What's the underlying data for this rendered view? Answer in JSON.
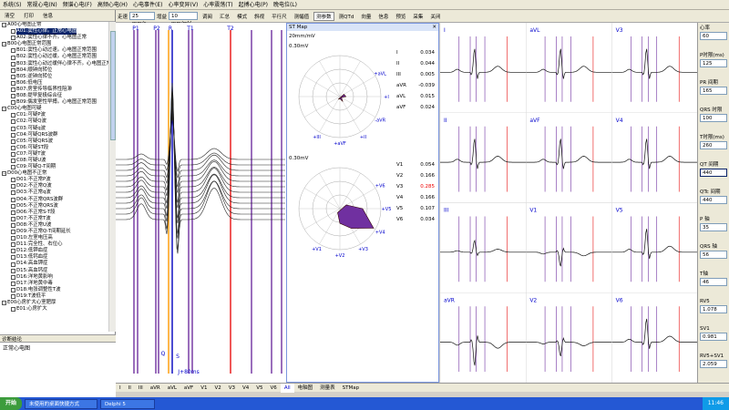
{
  "menu": [
    "系统(S)",
    "常规心电(N)",
    "频谱心电(F)",
    "高频心电(H)",
    "心电事件(E)",
    "心率变异(V)",
    "心率震荡(T)",
    "起搏心电(P)",
    "晚电位(L)"
  ],
  "toolbar": {
    "speed_label": "走速",
    "speed_value": "25 mm/s",
    "gain_label": "增益",
    "gain_value": "10 mm/mV",
    "buttons": [
      "调阅",
      "汇总",
      "模式",
      "斜视",
      "平行尺",
      "测幅值",
      "测参数",
      "测QTd",
      "向量",
      "信息",
      "预览",
      "采集",
      "关闭"
    ]
  },
  "left_header": {
    "clear": "清空",
    "print": "打印",
    "info": "信息"
  },
  "tree": [
    {
      "t": "A00心电图正常",
      "lvl": 0,
      "exp": true
    },
    {
      "t": "A01:窦性心律。正常心电图",
      "lvl": 1
    },
    {
      "t": "A02:窦性心律不齐。心电图正常",
      "lvl": 1
    },
    {
      "t": "B00心电图正常范围",
      "lvl": 0,
      "exp": true
    },
    {
      "t": "B01:窦性心动过速。心电图正常范围",
      "lvl": 1
    },
    {
      "t": "B02:窦性心动过缓。心电图正常范围",
      "lvl": 1
    },
    {
      "t": "B03:窦性心动过缓伴心律不齐。心电图正常范围",
      "lvl": 1
    },
    {
      "t": "B04:顺钟向转位",
      "lvl": 1
    },
    {
      "t": "B05:逆钟向转位",
      "lvl": 1
    },
    {
      "t": "B06:低电压",
      "lvl": 1
    },
    {
      "t": "B07:房室传导临界性阻滞",
      "lvl": 1
    },
    {
      "t": "B08:提早复极综合征",
      "lvl": 1
    },
    {
      "t": "B09:偶发室性早搏。心电图正常范围",
      "lvl": 1
    },
    {
      "t": "C00心电图可疑",
      "lvl": 0,
      "exp": true
    },
    {
      "t": "C01:可疑P波",
      "lvl": 1
    },
    {
      "t": "C02:可疑Q波",
      "lvl": 1
    },
    {
      "t": "C03:可疑q波",
      "lvl": 1
    },
    {
      "t": "C04:可疑QRS波群",
      "lvl": 1
    },
    {
      "t": "C05:可疑QRS波",
      "lvl": 1
    },
    {
      "t": "C06:可疑ST段",
      "lvl": 1
    },
    {
      "t": "C07:可疑T波",
      "lvl": 1
    },
    {
      "t": "C08:可疑U波",
      "lvl": 1
    },
    {
      "t": "C09:可疑Q-T间期",
      "lvl": 1
    },
    {
      "t": "D00心电图不正常",
      "lvl": 0,
      "exp": true
    },
    {
      "t": "D01:不正常P波",
      "lvl": 1
    },
    {
      "t": "D02:不正常Q波",
      "lvl": 1
    },
    {
      "t": "D03:不正常q波",
      "lvl": 1
    },
    {
      "t": "D04:不正常QRS波群",
      "lvl": 1
    },
    {
      "t": "D05:不正常QRS波",
      "lvl": 1
    },
    {
      "t": "D06:不正常S-T段",
      "lvl": 1
    },
    {
      "t": "D07:不正常T波",
      "lvl": 1
    },
    {
      "t": "D08:不正常U波",
      "lvl": 1
    },
    {
      "t": "D09:不正常Q-T间期延长",
      "lvl": 1
    },
    {
      "t": "D10:左室电压高",
      "lvl": 1
    },
    {
      "t": "D11:完全性、右位心",
      "lvl": 1
    },
    {
      "t": "D12:低钾血症",
      "lvl": 1
    },
    {
      "t": "D13:低钙血症",
      "lvl": 1
    },
    {
      "t": "D14:高血钾症",
      "lvl": 1
    },
    {
      "t": "D15:高血钙症",
      "lvl": 1
    },
    {
      "t": "D16:洋地黄影响",
      "lvl": 1
    },
    {
      "t": "D17:洋地黄中毒",
      "lvl": 1
    },
    {
      "t": "D18:电张调整性T波",
      "lvl": 1
    },
    {
      "t": "D19:T波低平",
      "lvl": 1
    },
    {
      "t": "E00心房扩大心室肥厚",
      "lvl": 0,
      "exp": true
    },
    {
      "t": "E01:心房扩大",
      "lvl": 1
    }
  ],
  "diag": {
    "header": "诊断结论",
    "text": "正常心电图"
  },
  "markers": {
    "p1": "P1",
    "p2": "P2",
    "r": "R",
    "t1": "T1",
    "t2": "T2",
    "q": "Q",
    "s": "S",
    "j": "J+80ms"
  },
  "stmap": {
    "title": "ST Map",
    "scale": "20mm/mV",
    "top_ring": "0.30mV",
    "bot_ring": "0.30mV",
    "limb": [
      {
        "n": "I",
        "v": "0.034"
      },
      {
        "n": "II",
        "v": "0.044"
      },
      {
        "n": "III",
        "v": "0.005"
      },
      {
        "n": "aVR",
        "v": "-0.039"
      },
      {
        "n": "aVL",
        "v": "0.015"
      },
      {
        "n": "aVF",
        "v": "0.024"
      }
    ],
    "chest": [
      {
        "n": "V1",
        "v": "0.054"
      },
      {
        "n": "V2",
        "v": "0.166"
      },
      {
        "n": "V3",
        "v": "0.285"
      },
      {
        "n": "V4",
        "v": "0.166"
      },
      {
        "n": "V5",
        "v": "0.107"
      },
      {
        "n": "V6",
        "v": "0.034"
      }
    ],
    "limb_axes": [
      "+aVL",
      "+I",
      "-aVR",
      "+II",
      "+aVF",
      "+III"
    ],
    "chest_axes": [
      "+V6",
      "+V5",
      "+V4",
      "+V3",
      "+V2",
      "+V1"
    ]
  },
  "grid_leads": [
    [
      "I",
      "aVL",
      "V3"
    ],
    [
      "II",
      "aVF",
      "V4"
    ],
    [
      "III",
      "V1",
      "V5"
    ],
    [
      "aVR",
      "V2",
      "V6"
    ]
  ],
  "right": [
    {
      "l": "心率",
      "v": "60"
    },
    {
      "l": "P时限(ms)",
      "v": "125"
    },
    {
      "l": "PR 间期",
      "v": "165"
    },
    {
      "l": "QRS 时限",
      "v": "100"
    },
    {
      "l": "T时限(ms)",
      "v": "260"
    },
    {
      "l": "QT 间期",
      "v": "440"
    },
    {
      "l": "QTc 间期",
      "v": "440"
    },
    {
      "l": "P 轴",
      "v": "35"
    },
    {
      "l": "QRS 轴",
      "v": "56"
    },
    {
      "l": "T轴",
      "v": "46"
    },
    {
      "l": "RV5",
      "v": "1.078"
    },
    {
      "l": "SV1",
      "v": "0.981"
    },
    {
      "l": "RV5+SV1",
      "v": "2.059"
    }
  ],
  "bottom_tabs": [
    "I",
    "II",
    "III",
    "aVR",
    "aVL",
    "aVF",
    "V1",
    "V2",
    "V3",
    "V4",
    "V5",
    "V6",
    "All",
    "电轴图",
    "测量表",
    "STMap"
  ],
  "bottom_active": "All",
  "taskbar": {
    "start": "开始",
    "t1": "未使用的桌面快捷方式",
    "t2": "Delphi 5",
    "clock": "11:46"
  },
  "colors": {
    "purple": "#7030a0",
    "orange": "#ff9900",
    "red": "#e81010",
    "blue": "#0000c0"
  }
}
